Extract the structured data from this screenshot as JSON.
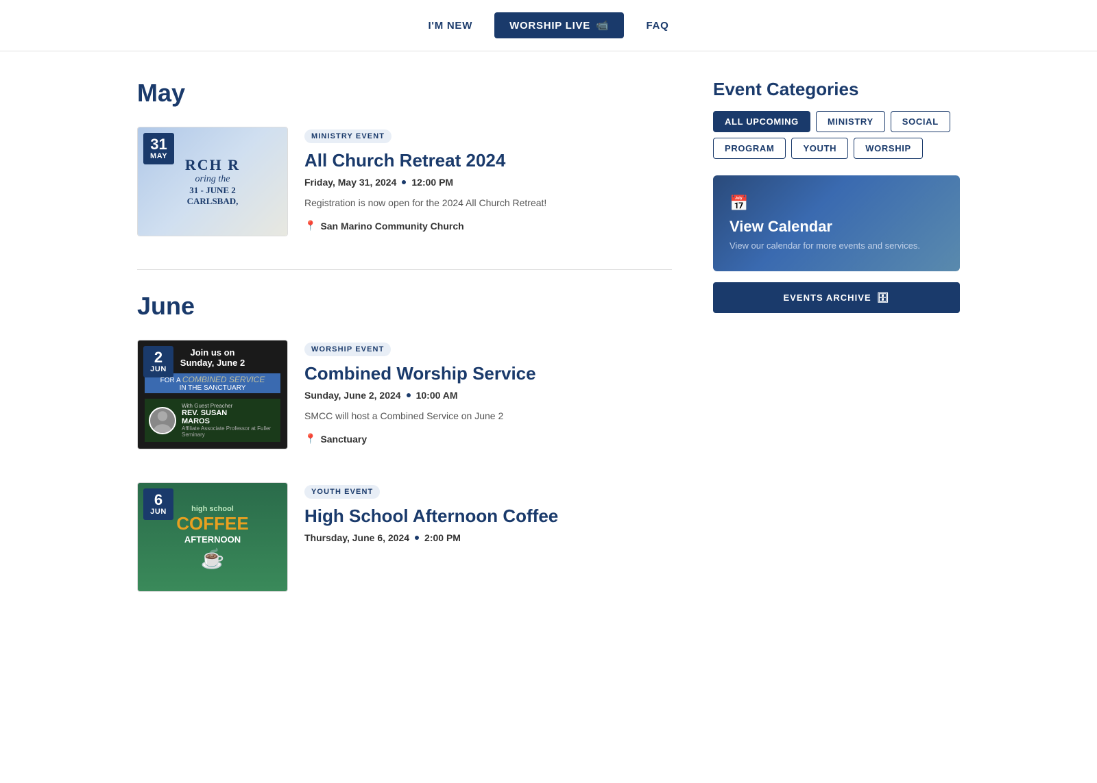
{
  "nav": {
    "im_new": "I'M NEW",
    "worship_live": "WORSHIP LIVE",
    "faq": "FAQ"
  },
  "months": [
    {
      "name": "May",
      "events": [
        {
          "id": "all-church-retreat",
          "day": "31",
          "month": "MAY",
          "category": "MINISTRY EVENT",
          "title": "All Church Retreat 2024",
          "date": "Friday, May 31, 2024",
          "time": "12:00 PM",
          "description": "Registration is now open for the 2024 All Church Retreat!",
          "location": "San Marino Community Church",
          "image_type": "retreat"
        }
      ]
    },
    {
      "name": "June",
      "events": [
        {
          "id": "combined-worship",
          "day": "2",
          "month": "JUN",
          "category": "WORSHIP EVENT",
          "title": "Combined Worship Service",
          "date": "Sunday, June 2, 2024",
          "time": "10:00 AM",
          "description": "SMCC will host a Combined Service on June 2",
          "location": "Sanctuary",
          "image_type": "worship"
        },
        {
          "id": "high-school-coffee",
          "day": "6",
          "month": "JUN",
          "category": "YOUTH EVENT",
          "title": "High School Afternoon Coffee",
          "date": "Thursday, June 6, 2024",
          "time": "2:00 PM",
          "description": "",
          "location": "",
          "image_type": "coffee"
        }
      ]
    }
  ],
  "sidebar": {
    "categories_title": "Event Categories",
    "filters": [
      {
        "label": "ALL UPCOMING",
        "active": true
      },
      {
        "label": "MINISTRY",
        "active": false
      },
      {
        "label": "SOCIAL",
        "active": false
      },
      {
        "label": "PROGRAM",
        "active": false
      },
      {
        "label": "YOUTH",
        "active": false
      },
      {
        "label": "WORSHIP",
        "active": false
      }
    ],
    "view_calendar": {
      "title": "View Calendar",
      "description": "View our calendar for more events and services."
    },
    "events_archive": "EVENTS ARCHIVE"
  }
}
